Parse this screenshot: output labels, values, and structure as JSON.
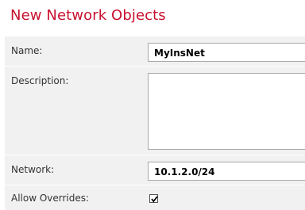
{
  "page": {
    "title": "New Network Objects"
  },
  "form": {
    "name": {
      "label": "Name:",
      "value": "MyInsNet"
    },
    "description": {
      "label": "Description:",
      "value": ""
    },
    "network": {
      "label": "Network:",
      "value": "10.1.2.0/24"
    },
    "allow_overrides": {
      "label": "Allow Overrides:",
      "checked": true
    }
  },
  "colors": {
    "title": "#c8102e",
    "panel_background": "#f1f1f1",
    "field_border": "#a9a9a9"
  }
}
